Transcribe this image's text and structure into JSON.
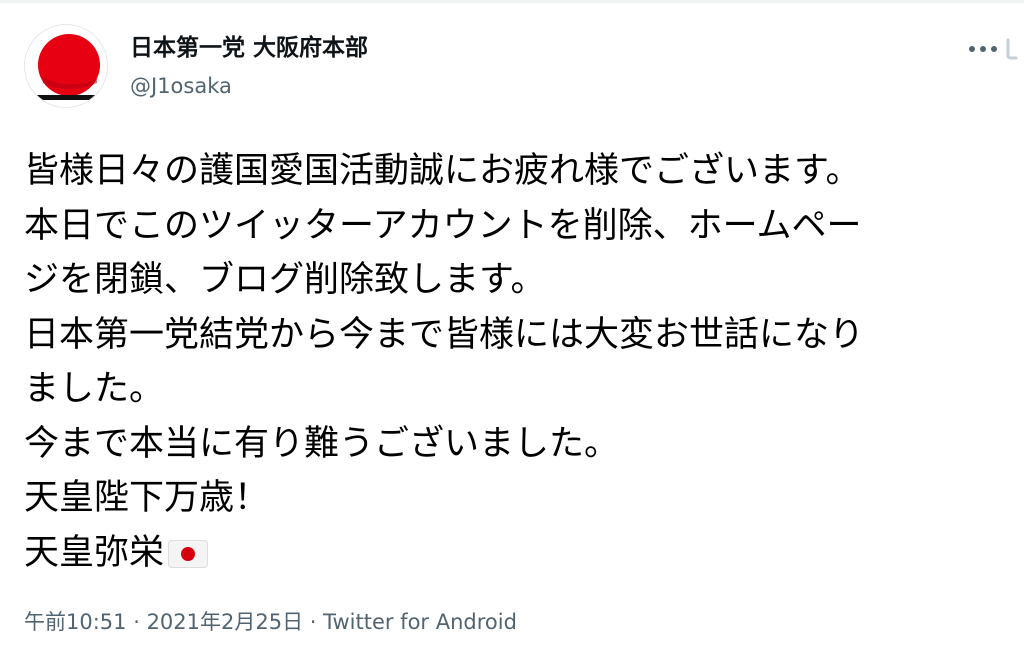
{
  "tweet": {
    "display_name": "日本第一党 大阪府本部",
    "handle": "@J1osaka",
    "avatar_icon": "hinomaru-avatar-icon",
    "more_icon": "more-options-icon",
    "body_lines": [
      "皆様日々の護国愛国活動誠にお疲れ様でございます。",
      "本日でこのツイッターアカウントを削除、ホームペー",
      "ジを閉鎖、ブログ削除致します。",
      "日本第一党結党から今まで皆様には大変お世話になり",
      "ました。",
      "今まで本当に有り難うございました。",
      "天皇陛下万歳！",
      "天皇弥栄"
    ],
    "flag_emoji": "japan-flag-icon",
    "time": "午前10:51",
    "separator": " · ",
    "date": "2021年2月25日",
    "source": "Twitter for Android"
  },
  "colors": {
    "text": "#0f1419",
    "secondary": "#536471",
    "red": "#e60012",
    "dark_red": "#8b0010"
  }
}
